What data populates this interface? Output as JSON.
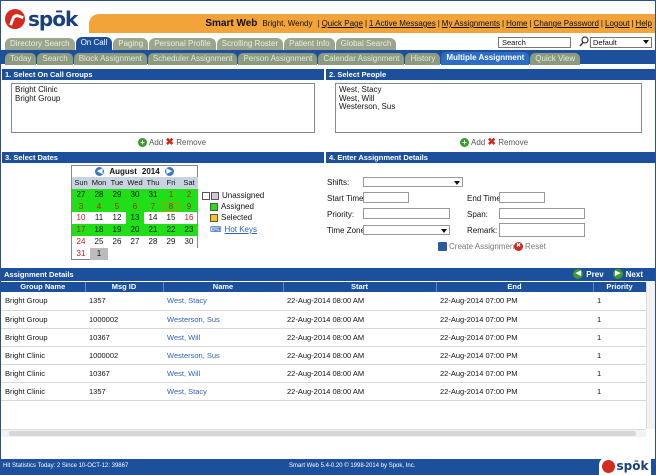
{
  "brand": {
    "logo_text": "spōk",
    "footer_logo_text": "spōk"
  },
  "header": {
    "app_name": "Smart Web",
    "user": "Bright, Wendy",
    "links": [
      "Quick Page",
      "1 Active Messages",
      "My Assignments",
      "Home",
      "Change Password",
      "Logout",
      "Help"
    ],
    "search_value": "Search",
    "scope_value": "Default"
  },
  "tabs_primary": [
    "Directory Search",
    "On Call",
    "Paging",
    "Personal Profile",
    "Scrolling Roster",
    "Patient Info",
    "Global Search"
  ],
  "tabs_secondary": [
    "Today",
    "Search",
    "Block Assignment",
    "Scheduler Assignment",
    "Person Assignment",
    "Calendar Assignment",
    "History",
    "Multiple Assignment",
    "Quick View"
  ],
  "sections": {
    "groups": {
      "title": "1. Select On Call Groups",
      "items": [
        "Bright Clinic",
        "Bright Group"
      ],
      "add": "Add",
      "remove": "Remove"
    },
    "people": {
      "title": "2. Select People",
      "items": [
        "West, Stacy",
        "West, Will",
        "Westerson, Sus"
      ],
      "add": "Add",
      "remove": "Remove"
    },
    "dates": {
      "title": "3. Select Dates"
    },
    "details": {
      "title": "4. Enter Assignment Details"
    }
  },
  "calendar": {
    "month": "August",
    "year": "2014",
    "dow": [
      "Sun",
      "Mon",
      "Tue",
      "Wed",
      "Thu",
      "Fri",
      "Sat"
    ],
    "weeks": [
      [
        {
          "d": "27",
          "s": "a"
        },
        {
          "d": "28",
          "s": "a"
        },
        {
          "d": "29",
          "s": "a"
        },
        {
          "d": "30",
          "s": "a"
        },
        {
          "d": "31",
          "s": "a"
        },
        {
          "d": "1",
          "s": "a red"
        },
        {
          "d": "2",
          "s": "a red"
        }
      ],
      [
        {
          "d": "3",
          "s": "a red"
        },
        {
          "d": "4",
          "s": "a red"
        },
        {
          "d": "5",
          "s": "a red"
        },
        {
          "d": "6",
          "s": "a red"
        },
        {
          "d": "7",
          "s": "a red"
        },
        {
          "d": "8",
          "s": "a red sel"
        },
        {
          "d": "9",
          "s": "a red"
        }
      ],
      [
        {
          "d": "10",
          "s": "red"
        },
        {
          "d": "11",
          "s": ""
        },
        {
          "d": "12",
          "s": ""
        },
        {
          "d": "13",
          "s": "a"
        },
        {
          "d": "14",
          "s": ""
        },
        {
          "d": "15",
          "s": ""
        },
        {
          "d": "16",
          "s": "red"
        }
      ],
      [
        {
          "d": "17",
          "s": "a red"
        },
        {
          "d": "18",
          "s": "a"
        },
        {
          "d": "19",
          "s": "a"
        },
        {
          "d": "20",
          "s": "a"
        },
        {
          "d": "21",
          "s": "a"
        },
        {
          "d": "22",
          "s": "a"
        },
        {
          "d": "23",
          "s": "a"
        }
      ],
      [
        {
          "d": "24",
          "s": "red"
        },
        {
          "d": "25",
          "s": ""
        },
        {
          "d": "26",
          "s": ""
        },
        {
          "d": "27",
          "s": ""
        },
        {
          "d": "28",
          "s": ""
        },
        {
          "d": "29",
          "s": ""
        },
        {
          "d": "30",
          "s": ""
        }
      ],
      [
        {
          "d": "31",
          "s": "red"
        },
        {
          "d": "1",
          "s": "hl"
        },
        {
          "d": "",
          "s": "empty"
        },
        {
          "d": "",
          "s": "empty"
        },
        {
          "d": "",
          "s": "empty"
        },
        {
          "d": "",
          "s": "empty"
        },
        {
          "d": "",
          "s": "empty"
        }
      ]
    ]
  },
  "legend": {
    "unassigned": "Unassigned",
    "assigned": "Assigned",
    "selected": "Selected",
    "hotkeys": "Hot Keys",
    "colors": {
      "unassigned": "#d9c3d9",
      "assigned": "#1fe016",
      "selected": "#f5c518"
    }
  },
  "form": {
    "shifts_label": "Shifts:",
    "shifts_value": "",
    "start_label": "Start Time:",
    "end_label": "End Time:",
    "priority_label": "Priority:",
    "span_label": "Span:",
    "tz_label": "Time Zone:",
    "remark_label": "Remark:",
    "create_label": "Create Assignment",
    "reset_label": "Reset"
  },
  "assignment_details": {
    "title": "Assignment Details",
    "prev": "Prev",
    "next": "Next",
    "columns": [
      "Group Name",
      "Msg ID",
      "Name",
      "Start",
      "End",
      "Priority"
    ],
    "rows": [
      [
        "Bright Group",
        "1357",
        "West, Stacy",
        "22-Aug-2014 08:00 AM",
        "22-Aug-2014 07:00 PM",
        "1"
      ],
      [
        "Bright Group",
        "1000002",
        "Westerson, Sus",
        "22-Aug-2014 08:00 AM",
        "22-Aug-2014 07:00 PM",
        "1"
      ],
      [
        "Bright Group",
        "10367",
        "West, Will",
        "22-Aug-2014 08:00 AM",
        "22-Aug-2014 07:00 PM",
        "1"
      ],
      [
        "Bright Clinic",
        "1000002",
        "Westerson, Sus",
        "22-Aug-2014 08:00 AM",
        "22-Aug-2014 07:00 PM",
        "1"
      ],
      [
        "Bright Clinic",
        "10367",
        "West, Will",
        "22-Aug-2014 08:00 AM",
        "22-Aug-2014 07:00 PM",
        "1"
      ],
      [
        "Bright Clinic",
        "1357",
        "West, Stacy",
        "22-Aug-2014 08:00 AM",
        "22-Aug-2014 07:00 PM",
        "1"
      ]
    ]
  },
  "footer": {
    "stats": "Hit Statistics Today: 2 Since 10-OCT-12: 39867",
    "version": "Smart Web 5.4-0.20 © 1998-2014 by Spok, Inc."
  }
}
